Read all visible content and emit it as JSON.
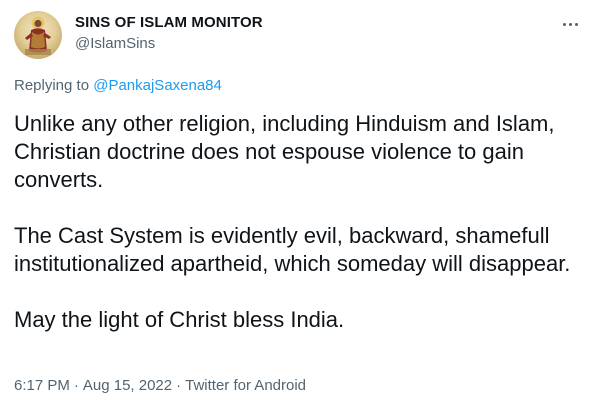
{
  "author": {
    "display_name": "SINS OF ISLAM MONITOR",
    "handle": "@IslamSins"
  },
  "reply": {
    "prefix": "Replying to",
    "to": "@PankajSaxena84"
  },
  "body": {
    "paragraphs": [
      "Unlike any other religion, including Hinduism and Islam, Christian doctrine does not espouse violence to gain converts.",
      "The Cast System is evidently evil, backward, shamefull institutionalized apartheid, which someday will disappear.",
      "May the light of Christ bless India."
    ]
  },
  "meta": {
    "time": "6:17 PM",
    "separator": "·",
    "date": "Aug 15, 2022",
    "source": "Twitter for Android"
  },
  "colors": {
    "text": "#0f1419",
    "secondary": "#536471",
    "link": "#1d9bf0"
  },
  "icons": {
    "more": "more-horizontal-icon"
  }
}
